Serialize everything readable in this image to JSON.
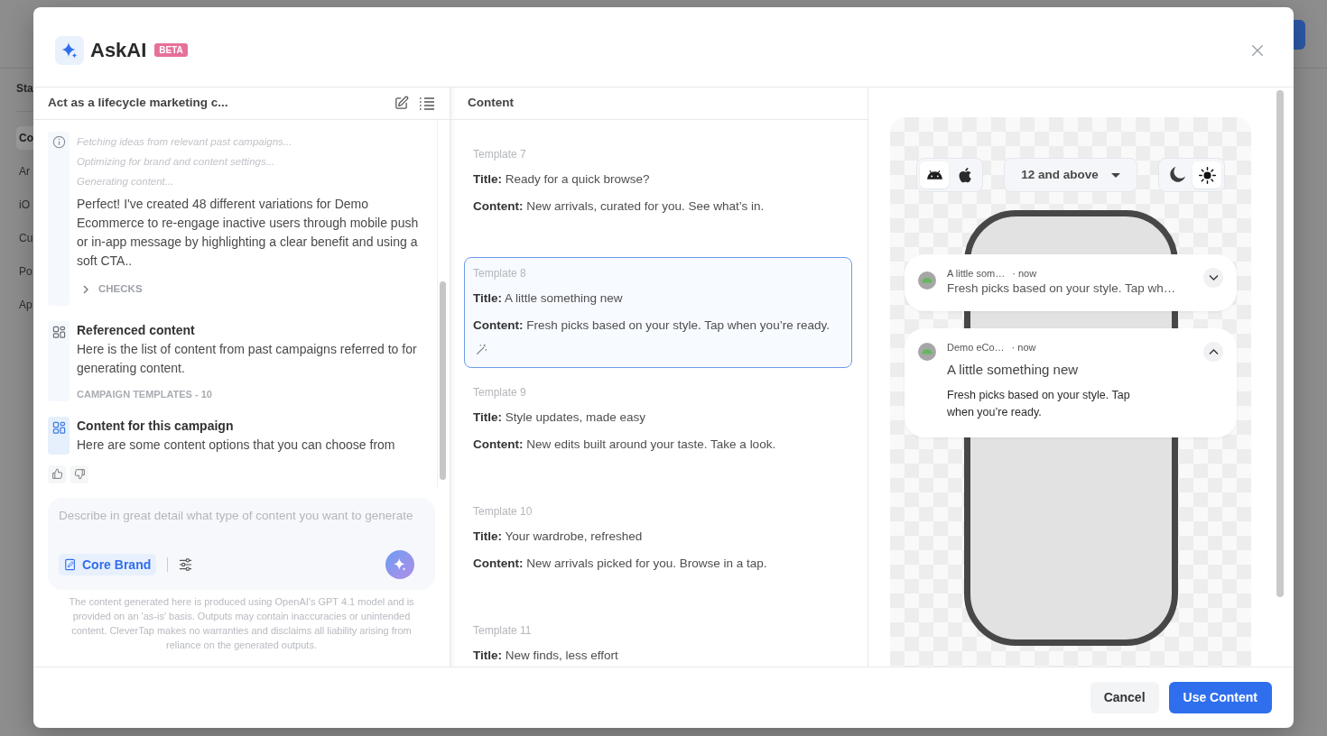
{
  "page": {
    "sidebar_heading": "Sta",
    "sidebar_items": [
      {
        "label": "Co",
        "selected": true
      },
      {
        "label": "Ar",
        "selected": false
      },
      {
        "label": "iO",
        "selected": false
      },
      {
        "label": "Cu",
        "selected": false
      },
      {
        "label": "Po",
        "selected": false
      },
      {
        "label": "Ap",
        "selected": false
      }
    ]
  },
  "dialog": {
    "title": "AskAI",
    "badge": "BETA"
  },
  "chat": {
    "title": "Act as a lifecycle marketing c...",
    "messages": [
      {
        "kind": "status",
        "steps": [
          "Fetching ideas from relevant past campaigns...",
          "Optimizing for brand and content settings...",
          "Generating content..."
        ],
        "text": "Perfect! I've created 48 different variations for Demo Ecommerce to re-engage inactive users through mobile push or in-app message by highlighting a clear benefit and using a soft CTA..",
        "checks": {
          "label": "CHECKS",
          "expanded": false
        }
      },
      {
        "kind": "reference",
        "heading": "Referenced content",
        "text": "Here is the list of content from past campaigns referred to for generating content.",
        "footer": "CAMPAIGN TEMPLATES - 10"
      },
      {
        "kind": "options",
        "heading": "Content for this campaign",
        "text": "Here are some content options that you can choose from"
      }
    ]
  },
  "composer": {
    "placeholder": "Describe in great detail what type of content you want to generate",
    "brand": "Core Brand"
  },
  "disclaimer": "The content generated here is produced using OpenAI's GPT 4.1 model and is provided on an 'as-is' basis. Outputs may contain inaccuracies or unintended content. CleverTap makes no warranties and disclaims all liability arising from reliance on the generated outputs.",
  "content_panel": {
    "title": "Content",
    "templates": [
      {
        "label": "Template 7",
        "title": "**Title:** Ready for a quick browse?",
        "content": "**Content:** New arrivals, curated for you. See what’s in.",
        "selected": false
      },
      {
        "label": "Template 8",
        "title": "**Title:** A little something new",
        "content": "**Content:** Fresh picks based on your style. Tap when you’re ready.",
        "selected": true
      },
      {
        "label": "Template 9",
        "title": "**Title:** Style updates, made easy",
        "content": "**Content:** New edits built around your taste. Take a look.",
        "selected": false
      },
      {
        "label": "Template 10",
        "title": "**Title:** Your wardrobe, refreshed",
        "content": "**Content:** New arrivals picked for you. Browse in a tap.",
        "selected": false
      },
      {
        "label": "Template 11",
        "title": "**Title:** New finds, less effort",
        "selected": false
      }
    ]
  },
  "preview": {
    "platforms": [
      {
        "kind": "android",
        "selected": true
      },
      {
        "kind": "apple",
        "selected": false
      }
    ],
    "version": "12 and above",
    "themes": [
      {
        "kind": "dark",
        "selected": false
      },
      {
        "kind": "light",
        "selected": true
      }
    ],
    "notifications": [
      {
        "expanded": false,
        "app": "A little som…",
        "time": "· now",
        "body": "Fresh picks based on your style. Tap wh…"
      },
      {
        "expanded": true,
        "app": "Demo eCo…",
        "time": "· now",
        "title": "A little something new",
        "body": "Fresh picks based on your style. Tap when you’re ready."
      }
    ]
  },
  "buttons": [
    {
      "label": "Cancel",
      "kind": "secondary"
    },
    {
      "label": "Use Content",
      "kind": "primary"
    }
  ]
}
